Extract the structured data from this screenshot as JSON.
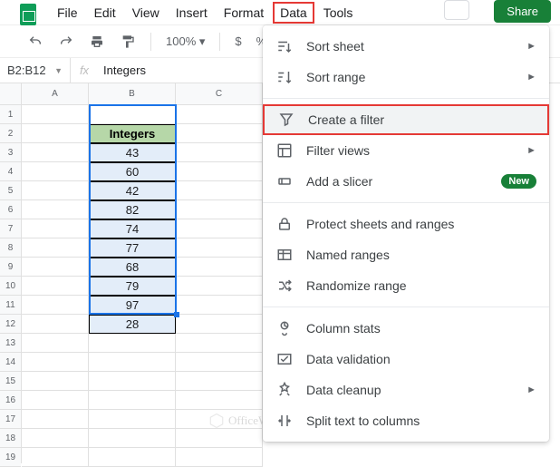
{
  "menubar": {
    "items": [
      "File",
      "Edit",
      "View",
      "Insert",
      "Format",
      "Data",
      "Tools"
    ],
    "highlighted_index": 5
  },
  "share_label": "Share",
  "toolbar": {
    "zoom": "100%",
    "currency": "$",
    "percent": "%"
  },
  "formula_bar": {
    "name_box": "B2:B12",
    "fx": "fx",
    "value": "Integers"
  },
  "columns": [
    "A",
    "B",
    "C"
  ],
  "rows_count": 19,
  "table": {
    "header": "Integers",
    "values": [
      43,
      60,
      42,
      82,
      74,
      77,
      68,
      79,
      97,
      28
    ]
  },
  "dropdown": {
    "sections": [
      [
        {
          "icon": "sort-sheet-icon",
          "label": "Sort sheet",
          "submenu": true
        },
        {
          "icon": "sort-range-icon",
          "label": "Sort range",
          "submenu": true
        }
      ],
      [
        {
          "icon": "filter-icon",
          "label": "Create a filter",
          "highlighted": true
        },
        {
          "icon": "filter-views-icon",
          "label": "Filter views",
          "submenu": true
        },
        {
          "icon": "slicer-icon",
          "label": "Add a slicer",
          "badge": "New"
        }
      ],
      [
        {
          "icon": "protect-icon",
          "label": "Protect sheets and ranges"
        },
        {
          "icon": "named-ranges-icon",
          "label": "Named ranges"
        },
        {
          "icon": "randomize-icon",
          "label": "Randomize range"
        }
      ],
      [
        {
          "icon": "column-stats-icon",
          "label": "Column stats"
        },
        {
          "icon": "data-validation-icon",
          "label": "Data validation"
        },
        {
          "icon": "data-cleanup-icon",
          "label": "Data cleanup",
          "submenu": true
        },
        {
          "icon": "split-text-icon",
          "label": "Split text to columns"
        }
      ]
    ]
  },
  "watermark": "OfficeWheel"
}
